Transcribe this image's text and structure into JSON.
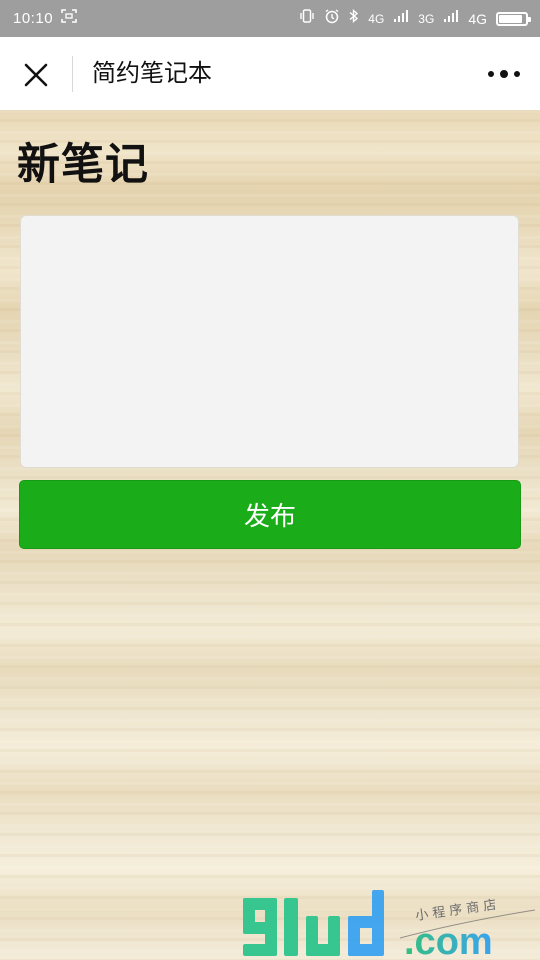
{
  "status_bar": {
    "time": "10:10",
    "net_small_1": "4G",
    "net_small_2": "3G",
    "network": "4G",
    "battery_level": 0.9
  },
  "nav": {
    "title": "简约笔记本",
    "close_icon": "close-icon",
    "more_icon": "more-dots-icon"
  },
  "page": {
    "title": "新笔记",
    "note_value": "",
    "publish_label": "发布"
  },
  "watermark": {
    "text": "91ud.com",
    "tagline": "小程序商店"
  },
  "colors": {
    "status_bar_bg": "#9e9e9e",
    "nav_bg": "#ffffff",
    "primary_button": "#1aad19",
    "textarea_bg": "#f3f3f3",
    "watermark_green": "#2ec58d",
    "watermark_blue": "#3aa3f0"
  }
}
